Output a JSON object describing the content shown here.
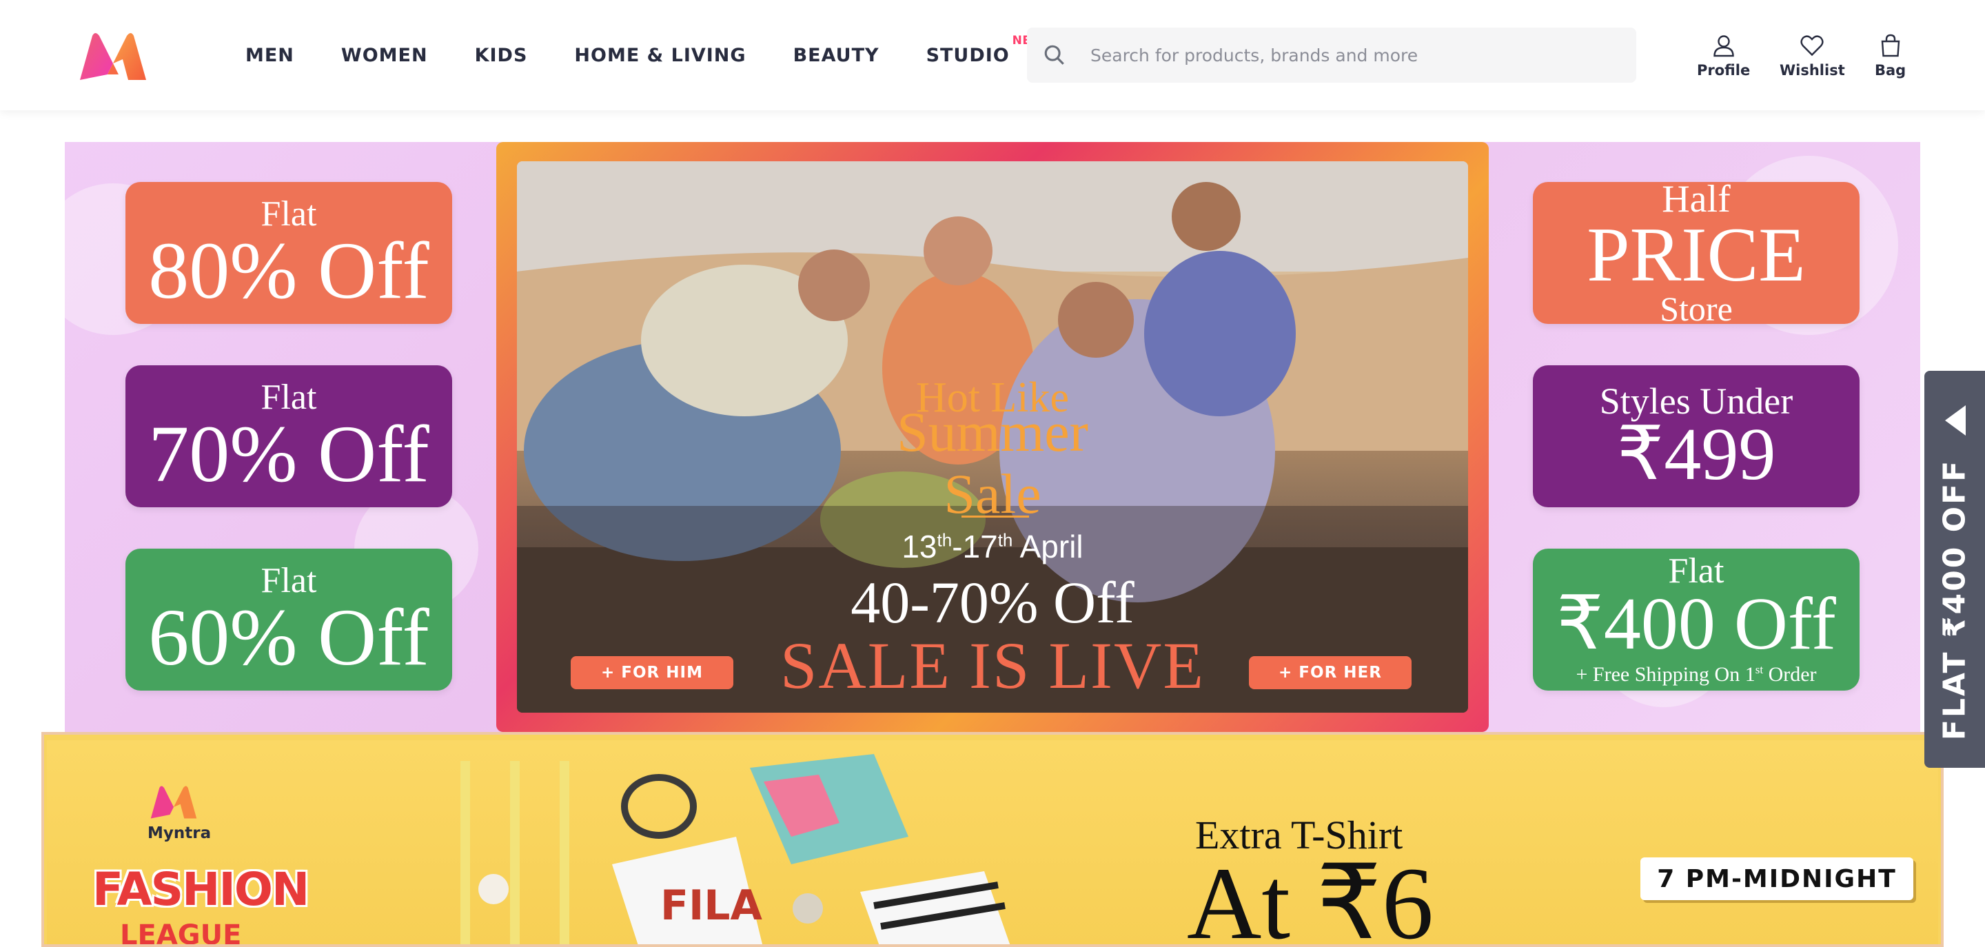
{
  "header": {
    "nav": [
      "MEN",
      "WOMEN",
      "KIDS",
      "HOME & LIVING",
      "BEAUTY",
      "STUDIO"
    ],
    "studio_badge": "NEW",
    "search_placeholder": "Search for products, brands and more",
    "actions": {
      "profile": "Profile",
      "wishlist": "Wishlist",
      "bag": "Bag"
    }
  },
  "hero": {
    "left_offers": [
      {
        "line1": "Flat",
        "line2": "80% Off",
        "color": "#ee7356"
      },
      {
        "line1": "Flat",
        "line2": "70% Off",
        "color": "#7b2581"
      },
      {
        "line1": "Flat",
        "line2": "60% Off",
        "color": "#46a35e"
      }
    ],
    "right_offers": {
      "half_price": {
        "line1": "Half",
        "line2": "PRICE",
        "line3": "Store"
      },
      "styles_under": {
        "line1": "Styles Under",
        "line2": "₹499"
      },
      "flat_400": {
        "line1": "Flat",
        "line2": "₹400 Off",
        "line3_pre": "+ Free Shipping On 1",
        "line3_sup": "st",
        "line3_post": " Order"
      }
    },
    "center": {
      "hot_like": "Hot Like",
      "summer": "Summer",
      "sale": "Sale",
      "date_start": "13",
      "date_start_sup": "th",
      "date_end": "-17",
      "date_end_sup": "th",
      "date_month": " April",
      "range": "40-70% Off",
      "live": "SALE IS LIVE",
      "for_him": "+ FOR HIM",
      "for_her": "+ FOR HER"
    }
  },
  "side_tab": {
    "text": "FLAT ₹400 OFF"
  },
  "league_banner": {
    "brand": "Myntra",
    "fashion": "FASHION",
    "league": "LEAGUE",
    "extra": "Extra T-Shirt",
    "price": "At ₹6",
    "time": "7 PM-MIDNIGHT"
  },
  "colors": {
    "brand_pink": "#ff3f6c",
    "text_dark": "#282c3f",
    "offer_orange": "#ee7356",
    "offer_purple": "#7b2581",
    "offer_green": "#46a35e"
  }
}
